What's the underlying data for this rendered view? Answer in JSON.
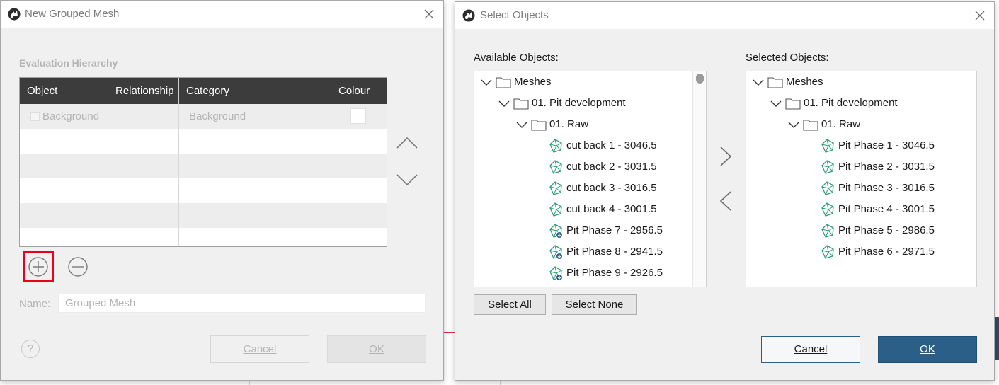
{
  "left_dialog": {
    "title": "New Grouped Mesh",
    "section_label": "Evaluation Hierarchy",
    "columns": [
      "Object",
      "Relationship",
      "Category",
      "Colour"
    ],
    "rows": [
      {
        "object": "Background",
        "relationship": "",
        "category": "Background",
        "colour": "#ffffff"
      }
    ],
    "name_label": "Name:",
    "name_placeholder": "Grouped Mesh",
    "help_label": "?",
    "cancel_label": "Cancel",
    "ok_label": "OK"
  },
  "right_dialog": {
    "title": "Select Objects",
    "available_label": "Available Objects:",
    "selected_label": "Selected Objects:",
    "available_tree": {
      "root": "Meshes",
      "folder": "01. Pit development",
      "subfolder": "01. Raw",
      "items": [
        "cut back 1 - 3046.5",
        "cut back 2 - 3031.5",
        "cut back 3 - 3016.5",
        "cut back 4 - 3001.5",
        "Pit Phase 7 - 2956.5",
        "Pit Phase 8 - 2941.5",
        "Pit Phase 9 - 2926.5"
      ]
    },
    "selected_tree": {
      "root": "Meshes",
      "folder": "01. Pit development",
      "subfolder": "01. Raw",
      "items": [
        "Pit Phase 1 - 3046.5",
        "Pit Phase 2 - 3031.5",
        "Pit Phase 3 - 3016.5",
        "Pit Phase 4 - 3001.5",
        "Pit Phase 5 - 2986.5",
        "Pit Phase 6 - 2971.5"
      ]
    },
    "select_all_label": "Select All",
    "select_none_label": "Select None",
    "cancel_label": "Cancel",
    "ok_label": "OK"
  },
  "colors": {
    "header_bg": "#3c3c3c",
    "primary_button": "#2b5f88",
    "mesh_icon": "#2e9e78",
    "highlight": "#e8001c"
  }
}
